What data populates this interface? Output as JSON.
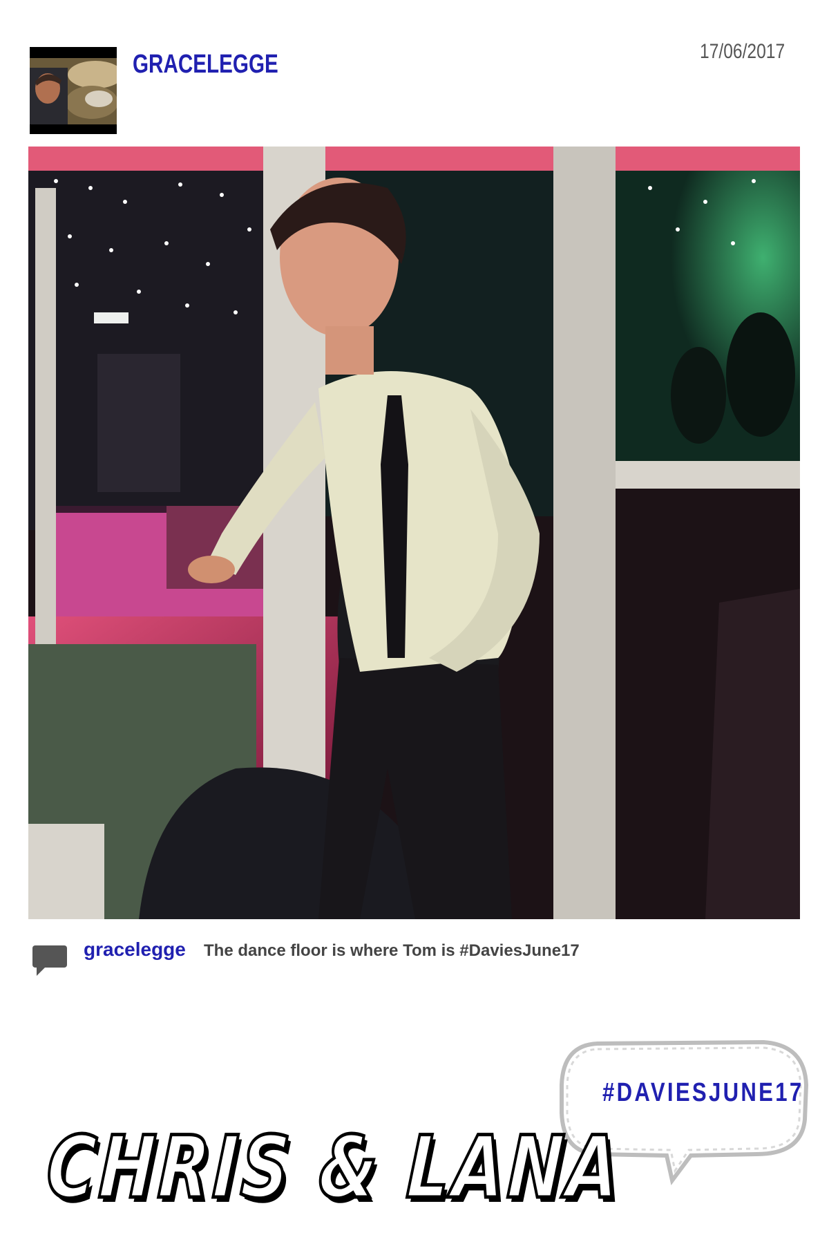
{
  "header": {
    "username": "GRACELEGGE",
    "date": "17/06/2017"
  },
  "post": {
    "caption_user": "gracelegge",
    "caption_text": "The dance floor is where Tom is #DaviesJune17"
  },
  "footer": {
    "hashtag": "#DAVIESJUNE17",
    "couple_title": "CHRIS & LANA"
  },
  "colors": {
    "accent_blue": "#2020b0",
    "caption_gray": "#444444"
  }
}
